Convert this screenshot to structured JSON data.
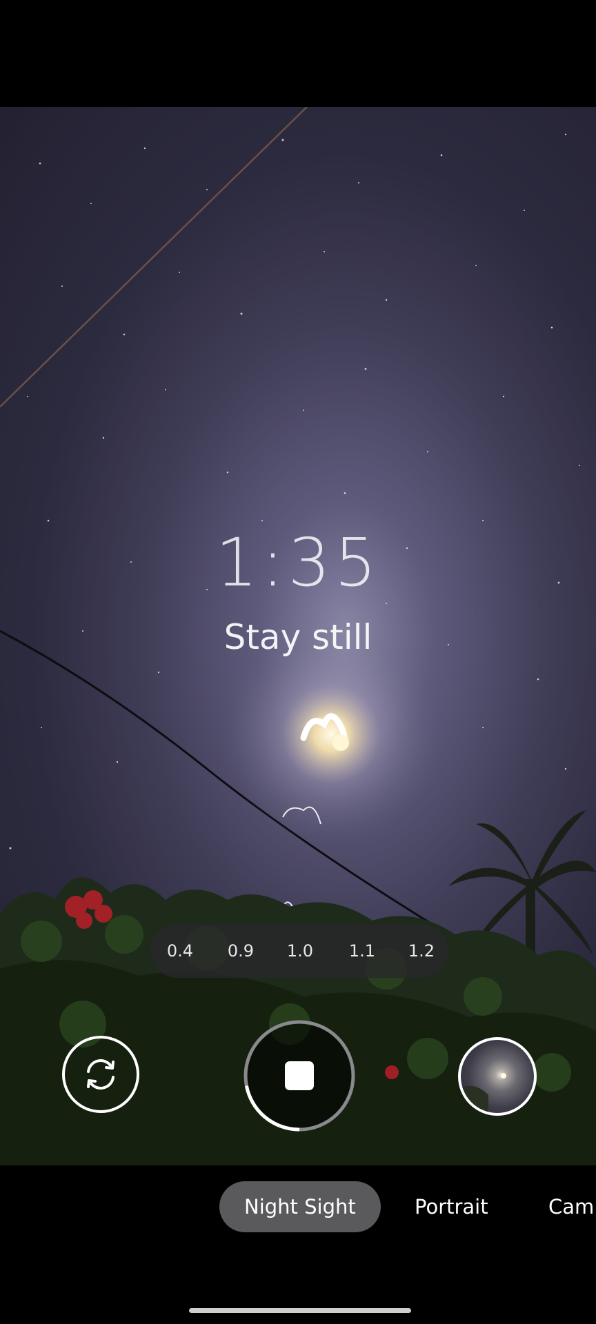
{
  "capture": {
    "timer": "1:35",
    "hint": "Stay still"
  },
  "zoom": {
    "levels": [
      "0.4",
      "0.9",
      "1.0",
      "1.1",
      "1.2"
    ],
    "selected": "1.0"
  },
  "controls": {
    "switch_camera_icon": "camera-switch-icon",
    "shutter_icon": "stop-icon",
    "capture_progress": 0.22
  },
  "modes": {
    "items": [
      "Night Sight",
      "Portrait",
      "Cam"
    ],
    "selected": "Night Sight"
  },
  "colors": {
    "sky": "#2c2a3e",
    "mode_active_bg": "#5a5a5c",
    "zoom_bar_bg": "#28282c"
  }
}
